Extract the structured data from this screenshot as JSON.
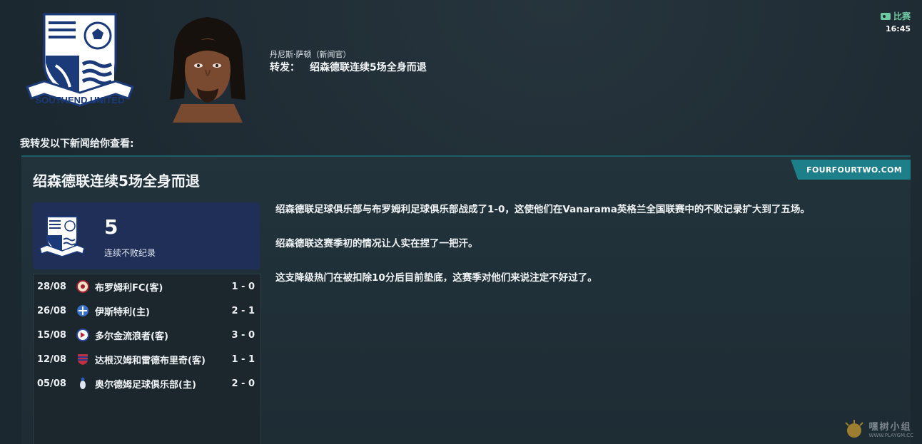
{
  "header": {
    "club_crest_text": "SOUTHEND UNITED",
    "sender": "丹尼斯·萨顿（新闻官）",
    "subject_prefix": "转发：",
    "subject_title": "绍森德联连续5场全身而退",
    "match_link": "比赛",
    "time": "16:45"
  },
  "intro": "我转发以下新闻给你查看:",
  "article": {
    "source": "FOURFOURTWO.COM",
    "headline": "绍森德联连续5场全身而退",
    "stat_value": "5",
    "stat_label": "连续不败纪录",
    "paragraphs": [
      "绍森德联足球俱乐部与布罗姆利足球俱乐部战成了1-0，这使他们在Vanarama英格兰全国联赛中的不败记录扩大到了五场。",
      "绍森德联这赛季初的情况让人实在捏了一把汗。",
      "这支降级热门在被扣除10分后目前垫底，这赛季对他们来说注定不好过了。"
    ]
  },
  "results": [
    {
      "date": "28/08",
      "team": "布罗姆利FC(客)",
      "score": "1 - 0",
      "icon": "bromley-crest-icon"
    },
    {
      "date": "26/08",
      "team": "伊斯特利(主)",
      "score": "2 - 1",
      "icon": "eastleigh-crest-icon"
    },
    {
      "date": "15/08",
      "team": "多尔金流浪者(客)",
      "score": "3 - 0",
      "icon": "dorking-crest-icon"
    },
    {
      "date": "12/08",
      "team": "达根汉姆和雷德布里奇(客)",
      "score": "1 - 1",
      "icon": "dagenham-crest-icon"
    },
    {
      "date": "05/08",
      "team": "奥尔德姆足球俱乐部(主)",
      "score": "2 - 0",
      "icon": "oldham-crest-icon"
    }
  ],
  "watermark": {
    "cn": "嘿树小组",
    "url": "WWW.PLAYGM.CC"
  },
  "colors": {
    "background": "#1f2c35",
    "accent_teal": "#1d7f8a",
    "stat_box": "#1f2f58",
    "match_green": "#6ec8a0"
  }
}
